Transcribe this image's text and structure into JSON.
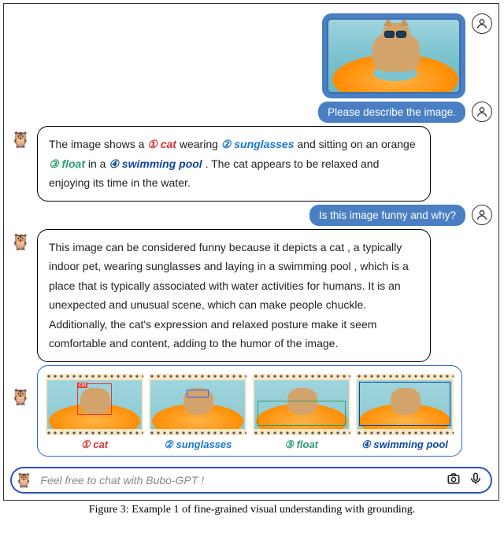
{
  "user_messages": {
    "describe": "Please describe the image.",
    "funny": "Is this image funny and why?"
  },
  "ai_response_1": {
    "pre1": "The image shows a ",
    "tag1": "① cat",
    "mid1": " wearing ",
    "tag2": "② sunglasses",
    "mid2": " and sitting on an orange ",
    "tag3": "③ float",
    "mid3": " in a ",
    "tag4": "④ swimming pool",
    "post": " . The cat appears to be relaxed and enjoying its time in the water."
  },
  "ai_response_2": "This image can be considered funny because it depicts a cat , a typically indoor pet, wearing sunglasses and laying in a swimming pool , which is a place that is typically associated with water activities for humans. It is an unexpected and unusual scene, which can make people chuckle. Additionally, the cat's expression and relaxed posture make it seem comfortable and content, adding to the humor of the image.",
  "grounding": {
    "items": [
      {
        "label": "① cat",
        "color": "red"
      },
      {
        "label": "② sunglasses",
        "color": "blue"
      },
      {
        "label": "③ float",
        "color": "green"
      },
      {
        "label": "④ swimming pool",
        "color": "dblue"
      }
    ]
  },
  "input_placeholder": "Feel free to chat with Bubo-GPT !",
  "caption": "Figure 3: Example 1 of fine-grained visual understanding with grounding.",
  "avatars": {
    "user_glyph": "☺",
    "ai_glyph": "🦉"
  },
  "icons": {
    "camera": "📷",
    "mic": "🎤"
  }
}
